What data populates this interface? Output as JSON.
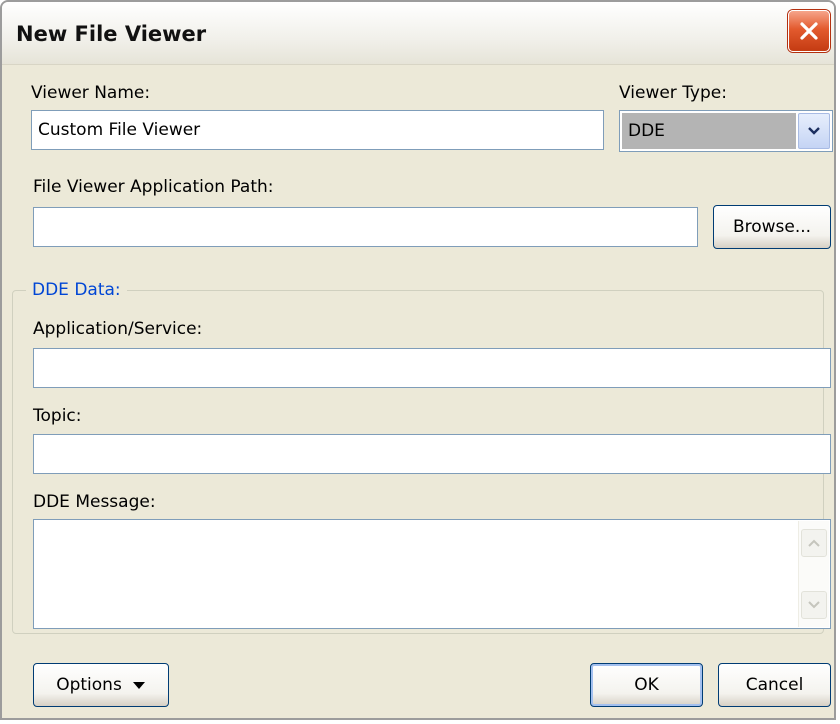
{
  "window": {
    "title": "New File Viewer"
  },
  "viewer_name": {
    "label": "Viewer Name:",
    "value": "Custom File Viewer"
  },
  "viewer_type": {
    "label": "Viewer Type:",
    "selected": "DDE"
  },
  "app_path": {
    "label": "File Viewer Application Path:",
    "value": "",
    "browse_label": "Browse..."
  },
  "dde": {
    "group_title": "DDE Data:",
    "service_label": "Application/Service:",
    "service_value": "",
    "topic_label": "Topic:",
    "topic_value": "",
    "message_label": "DDE Message:",
    "message_value": ""
  },
  "footer": {
    "options_label": "Options",
    "ok_label": "OK",
    "cancel_label": "Cancel"
  },
  "colors": {
    "dialog_bg": "#ece9d8",
    "group_title": "#0046d5",
    "close_button": "#e35a2e",
    "input_border": "#7f9db9",
    "selection_bg": "#b4b4b4"
  }
}
